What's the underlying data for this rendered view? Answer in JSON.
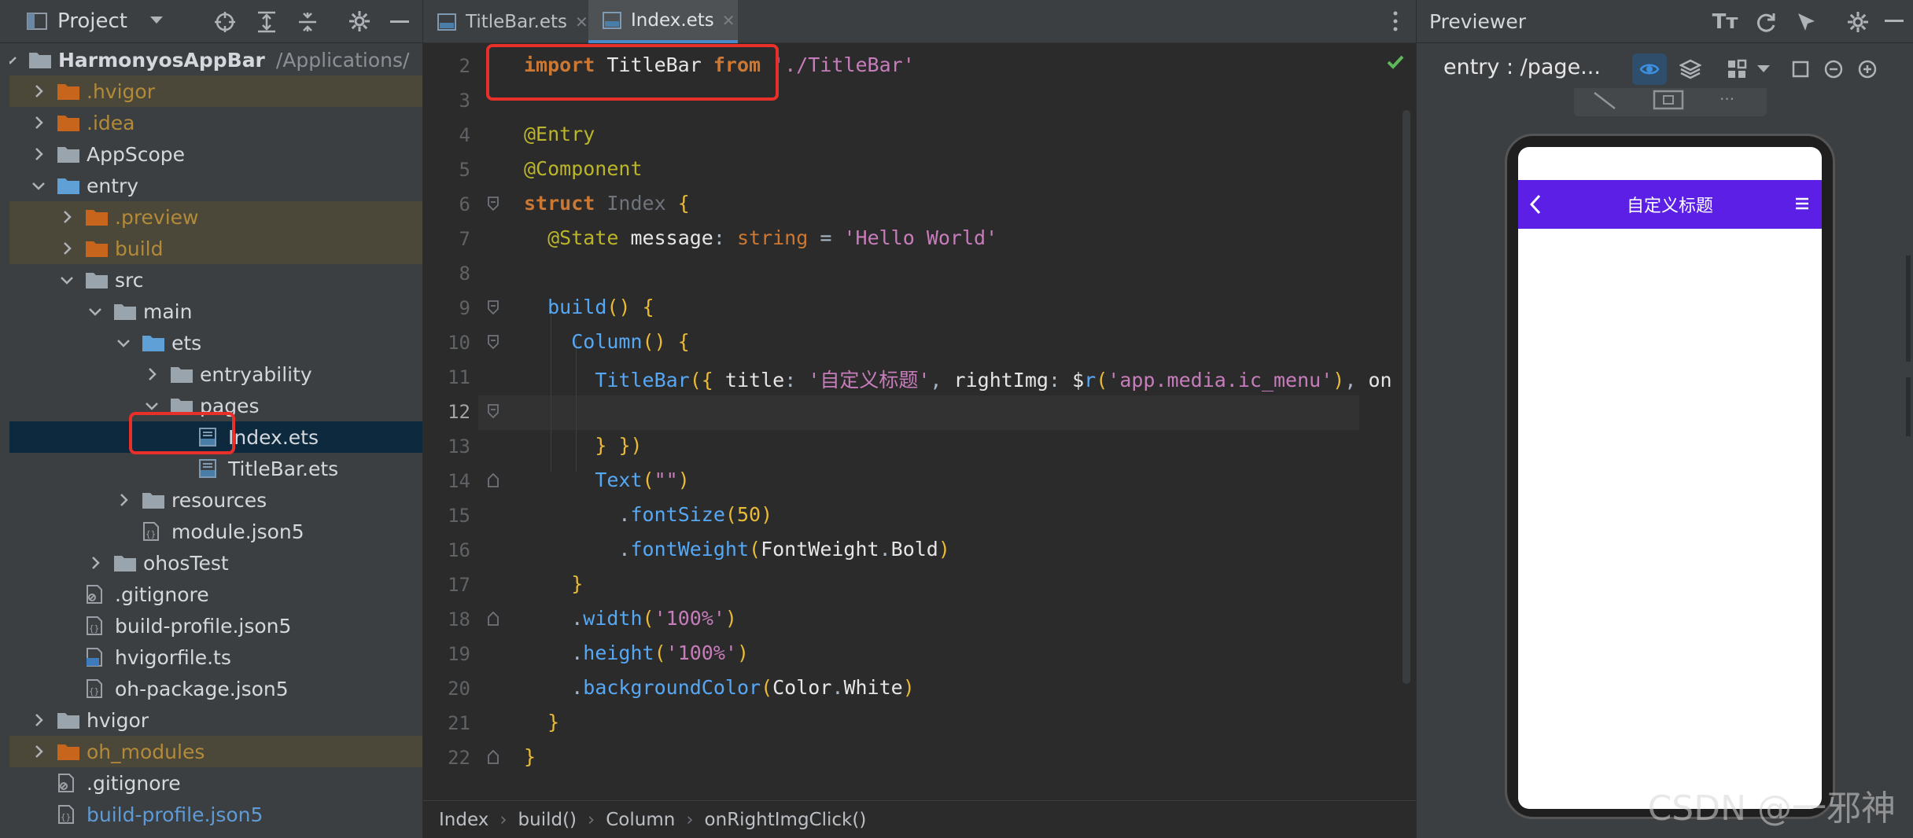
{
  "project_panel": {
    "title": "Project",
    "tree": [
      {
        "label": "HarmonyosAppBar",
        "extra": "/Applications/",
        "icon": "folder-icon",
        "expanded": true,
        "level": 0,
        "color": "#d4d7db",
        "bold": true
      },
      {
        "label": ".hvigor",
        "icon": "folder-icon",
        "expanded": false,
        "level": 1,
        "color": "#b28a38",
        "highlight": true
      },
      {
        "label": ".idea",
        "icon": "folder-icon",
        "expanded": false,
        "level": 1,
        "color": "#b28a38"
      },
      {
        "label": "AppScope",
        "icon": "folder-icon",
        "expanded": false,
        "level": 1,
        "color": "#d4d7db"
      },
      {
        "label": "entry",
        "icon": "folder-icon",
        "expanded": true,
        "level": 1,
        "color": "#d4d7db"
      },
      {
        "label": ".preview",
        "icon": "folder-icon",
        "expanded": false,
        "level": 2,
        "color": "#b28a38",
        "highlight": true
      },
      {
        "label": "build",
        "icon": "folder-icon",
        "expanded": false,
        "level": 2,
        "color": "#b28a38",
        "highlight": true
      },
      {
        "label": "src",
        "icon": "folder-icon",
        "expanded": true,
        "level": 2,
        "color": "#d4d7db"
      },
      {
        "label": "main",
        "icon": "folder-icon",
        "expanded": true,
        "level": 3,
        "color": "#d4d7db"
      },
      {
        "label": "ets",
        "icon": "folder-icon",
        "expanded": true,
        "level": 4,
        "color": "#d4d7db"
      },
      {
        "label": "entryability",
        "icon": "folder-icon",
        "expanded": false,
        "level": 5,
        "color": "#d4d7db"
      },
      {
        "label": "pages",
        "icon": "folder-icon",
        "expanded": true,
        "level": 5,
        "color": "#d4d7db"
      },
      {
        "label": "Index.ets",
        "icon": "ets-file-icon",
        "level": 6,
        "color": "#d4d7db",
        "selected": true
      },
      {
        "label": "TitleBar.ets",
        "icon": "ets-file-icon",
        "level": 6,
        "color": "#d4d7db"
      },
      {
        "label": "resources",
        "icon": "folder-icon",
        "expanded": false,
        "level": 4,
        "color": "#d4d7db"
      },
      {
        "label": "module.json5",
        "icon": "json-file-icon",
        "level": 4,
        "color": "#d4d7db"
      },
      {
        "label": "ohosTest",
        "icon": "folder-icon",
        "expanded": false,
        "level": 3,
        "color": "#d4d7db"
      },
      {
        "label": ".gitignore",
        "icon": "gitignore-file-icon",
        "level": 2,
        "color": "#d4d7db"
      },
      {
        "label": "build-profile.json5",
        "icon": "json-file-icon",
        "level": 2,
        "color": "#d4d7db"
      },
      {
        "label": "hvigorfile.ts",
        "icon": "ts-file-icon",
        "level": 2,
        "color": "#d4d7db"
      },
      {
        "label": "oh-package.json5",
        "icon": "json-file-icon",
        "level": 2,
        "color": "#d4d7db"
      },
      {
        "label": "hvigor",
        "icon": "folder-icon",
        "expanded": false,
        "level": 1,
        "color": "#d4d7db"
      },
      {
        "label": "oh_modules",
        "icon": "folder-icon",
        "expanded": false,
        "level": 1,
        "color": "#b28a38",
        "highlight": true
      },
      {
        "label": ".gitignore",
        "icon": "gitignore-file-icon",
        "level": 1,
        "color": "#d4d7db"
      },
      {
        "label": "build-profile.json5",
        "icon": "json-file-icon",
        "level": 1,
        "color": "#5e9bd6"
      }
    ]
  },
  "editor": {
    "tabs": [
      {
        "label": "TitleBar.ets",
        "active": false
      },
      {
        "label": "Index.ets",
        "active": true
      }
    ],
    "lines": [
      {
        "n": "2",
        "code": "import TitleBar from './TitleBar'"
      },
      {
        "n": "3",
        "code": ""
      },
      {
        "n": "4",
        "code": "@Entry"
      },
      {
        "n": "5",
        "code": "@Component"
      },
      {
        "n": "6",
        "code": "struct Index {"
      },
      {
        "n": "7",
        "code": "  @State message: string = 'Hello World'"
      },
      {
        "n": "8",
        "code": ""
      },
      {
        "n": "9",
        "code": "  build() {"
      },
      {
        "n": "10",
        "code": "    Column() {"
      },
      {
        "n": "11",
        "code": "      TitleBar({ title: '自定义标题', rightImg: $r('app.media.ic_menu'), on"
      },
      {
        "n": "12",
        "code": ""
      },
      {
        "n": "13",
        "code": "      } })"
      },
      {
        "n": "14",
        "code": "      Text(\"\")"
      },
      {
        "n": "15",
        "code": "        .fontSize(50)"
      },
      {
        "n": "16",
        "code": "        .fontWeight(FontWeight.Bold)"
      },
      {
        "n": "17",
        "code": "    }"
      },
      {
        "n": "18",
        "code": "    .width('100%')"
      },
      {
        "n": "19",
        "code": "    .height('100%')"
      },
      {
        "n": "20",
        "code": "    .backgroundColor(Color.White)"
      },
      {
        "n": "21",
        "code": "  }"
      },
      {
        "n": "22",
        "code": "}"
      }
    ],
    "breadcrumb": [
      "Index",
      "build()",
      "Column",
      "onRightImgClick()"
    ]
  },
  "previewer": {
    "title": "Previewer",
    "page_selector": "entry : /page...",
    "app_title": "自定义标题"
  },
  "watermark": "CSDN @一邪神",
  "colors": {
    "accent": "#4a88c7",
    "titlebar": "#5b1fe6",
    "highlight_box": "#e8302b"
  }
}
